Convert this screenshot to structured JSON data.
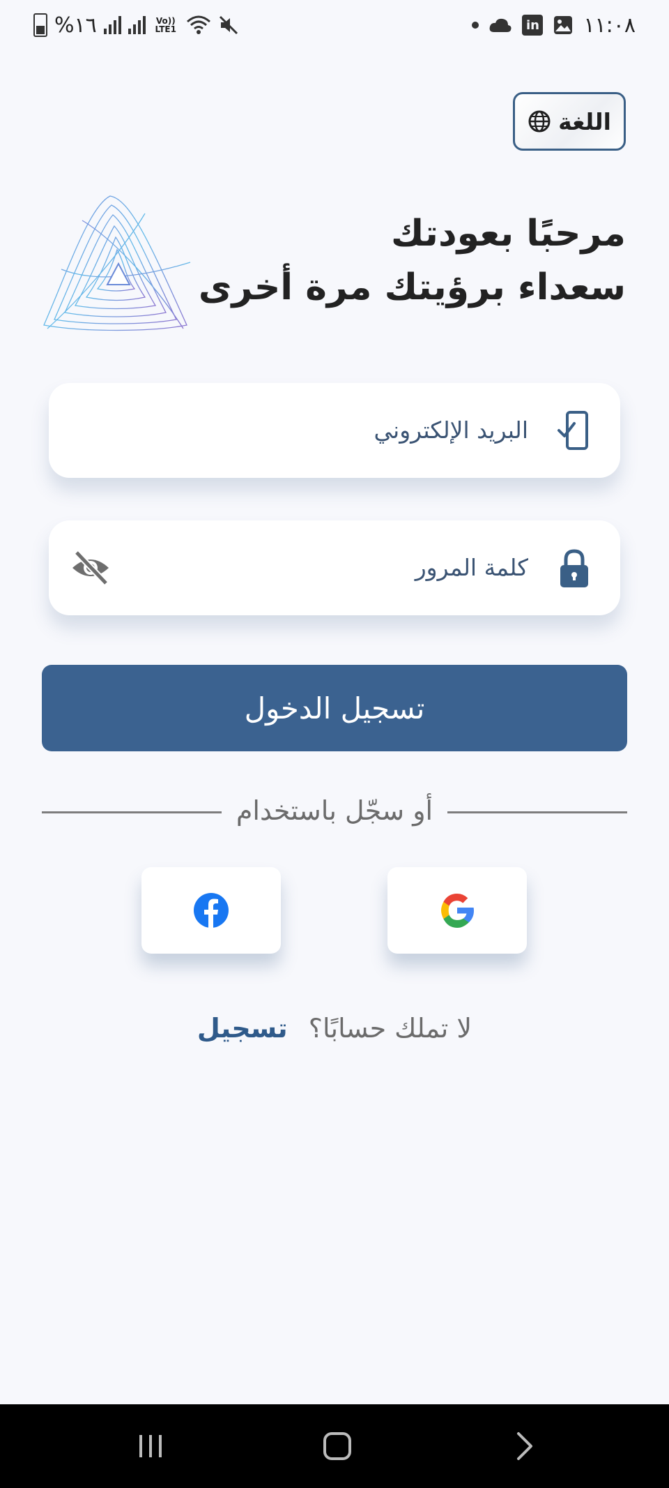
{
  "status_bar": {
    "time": "١١:٠٨",
    "battery": "%١٦",
    "network": "Vo)) LTE1"
  },
  "language_button": {
    "label": "اللغة",
    "icon": "globe-icon"
  },
  "header": {
    "title": "مرحبًا بعودتك",
    "subtitle": "سعداء برؤيتك مرة أخرى"
  },
  "form": {
    "email_placeholder": "البريد الإلكتروني",
    "password_placeholder": "كلمة المرور",
    "login_label": "تسجيل الدخول"
  },
  "divider_text": "أو سجّل باستخدام",
  "social": [
    {
      "name": "facebook",
      "icon": "facebook-icon"
    },
    {
      "name": "google",
      "icon": "google-icon"
    }
  ],
  "signup": {
    "prompt": "لا تملك حسابًا؟",
    "link": "تسجيل"
  },
  "colors": {
    "primary": "#3b6290",
    "accent": "#2f5a8a",
    "background": "#f7f8fc"
  }
}
